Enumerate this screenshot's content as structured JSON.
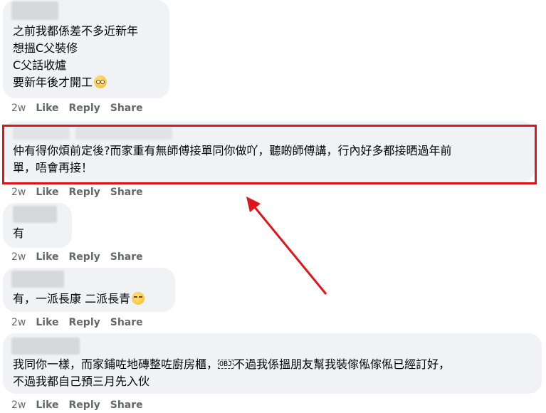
{
  "comments": [
    {
      "lines": [
        "之前我都係差不多近新年",
        "想搵C父裝修",
        "C父話收爐",
        "要新年後才開工"
      ],
      "emoji": "rolling-eyes-emoji",
      "time": "2w",
      "like": "Like",
      "reply": "Reply",
      "share": "Share"
    },
    {
      "lines": [
        "仲有得你煩前定後?而家重有無師傅接單同你做吖，聽啲師傅講，行內好多都接晒過年前",
        "單，唔會再接！"
      ],
      "time": "2w",
      "like": "Like",
      "reply": "Reply",
      "share": "Share"
    },
    {
      "lines": [
        "有"
      ],
      "time": "2w",
      "like": "Like",
      "reply": "Reply",
      "share": "Share"
    },
    {
      "text": "有，一派長康 二派長青",
      "emoji": "relieved-face-emoji",
      "time": "2w",
      "like": "Like",
      "reply": "Reply",
      "share": "Share"
    },
    {
      "line1_a": "我同你一樣，而家鋪咗地磚整咗廚房櫃，",
      "obj": "OBJ",
      "line1_b": "不過我係搵朋友幫我裝傢俬傢俬已經訂好，",
      "line2": "不過我都自己預三月先入伙",
      "time": "2w",
      "like": "Like",
      "reply": "Reply",
      "share": "Share"
    }
  ],
  "annotation": {
    "highlight_color": "#e0141b",
    "arrow_color": "#e0141b"
  }
}
